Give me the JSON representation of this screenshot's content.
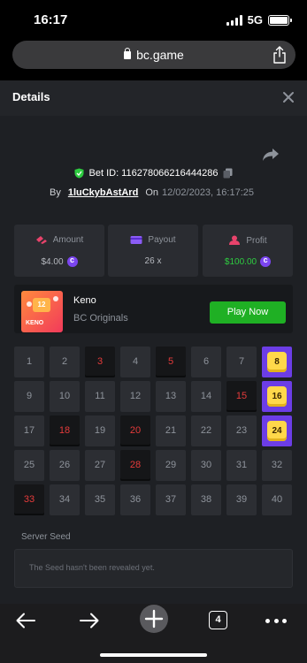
{
  "status_bar": {
    "time": "16:17",
    "network": "5G"
  },
  "browser": {
    "url": "bc.game",
    "tab_count": "4"
  },
  "modal": {
    "title": "Details",
    "bet_id_label": "Bet ID: 116278066216444286",
    "by_label": "By",
    "username": "1luCkybAstArd",
    "on_label": "On",
    "date": "12/02/2023, 16:17:25"
  },
  "stats": [
    {
      "label": "Amount",
      "value": "$4.00",
      "icon": "amount-icon",
      "value_color": "#b6b9bf",
      "has_coin": true
    },
    {
      "label": "Payout",
      "value": "26 x",
      "icon": "payout-icon",
      "value_color": "#b6b9bf",
      "has_coin": false
    },
    {
      "label": "Profit",
      "value": "$100.00",
      "icon": "profit-icon",
      "value_color": "#2ecc40",
      "has_coin": true
    }
  ],
  "game": {
    "name": "Keno",
    "provider": "BC Originals",
    "play_label": "Play Now",
    "thumb_number": "12",
    "thumb_label": "KENO"
  },
  "keno": {
    "numbers": [
      "1",
      "2",
      "3",
      "4",
      "5",
      "6",
      "7",
      "8",
      "9",
      "10",
      "11",
      "12",
      "13",
      "14",
      "15",
      "16",
      "17",
      "18",
      "19",
      "20",
      "21",
      "22",
      "23",
      "24",
      "25",
      "26",
      "27",
      "28",
      "29",
      "30",
      "31",
      "32",
      "33",
      "34",
      "35",
      "36",
      "37",
      "38",
      "39",
      "40"
    ],
    "drawn": [
      3,
      5,
      15,
      18,
      20,
      28,
      33
    ],
    "hits": [
      8,
      16,
      24
    ]
  },
  "seed": {
    "label": "Server Seed",
    "text": "The Seed hasn't been revealed yet."
  },
  "colors": {
    "accent_green": "#1fb024",
    "hit_purple": "#6c3de6",
    "hit_ball": "#ffd84a",
    "drawn_red": "#e53b3b",
    "coin": "#7b45f0"
  }
}
